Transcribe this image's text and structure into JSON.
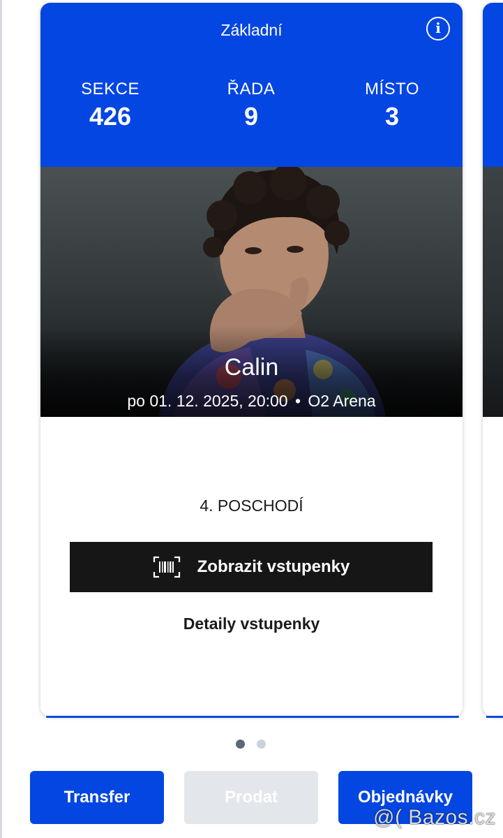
{
  "ticket": {
    "type_label": "Základní",
    "section_label": "SEKCE",
    "section_value": "426",
    "row_label": "ŘADA",
    "row_value": "9",
    "seat_label": "MÍSTO",
    "seat_value": "3",
    "artist": "Calin",
    "date_time": "po 01. 12. 2025, 20:00",
    "separator": "•",
    "venue": "O2 Arena",
    "floor": "4. POSCHODÍ",
    "show_tickets_label": "Zobrazit vstupenky",
    "details_label": "Detaily vstupenky"
  },
  "pager": {
    "total": 2,
    "active_index": 0
  },
  "actions": {
    "transfer_label": "Transfer",
    "sell_label": "Prodat",
    "orders_label": "Objednávky"
  },
  "watermark": "@( Bazos.cz",
  "colors": {
    "brand_blue": "#0346e1",
    "button_dark": "#161616",
    "disabled_gray": "#e3e6ea",
    "active_dot": "#5f6773",
    "inactive_dot": "#cdd2da"
  },
  "icons": {
    "info": "info-circle-icon",
    "barcode": "barcode-scan-icon"
  }
}
